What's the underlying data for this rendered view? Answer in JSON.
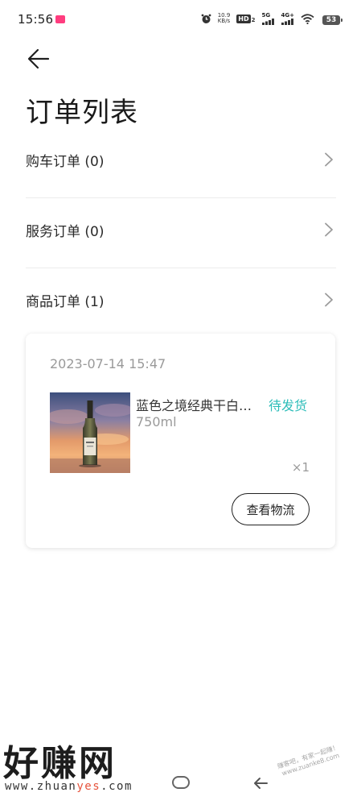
{
  "status_bar": {
    "time": "15:56",
    "net_speed_value": "10.9",
    "net_speed_unit": "KB/s",
    "hd_label": "HD",
    "hd_index": "2",
    "signal1_label": "5G",
    "signal2_label": "4G+",
    "battery_level": "53"
  },
  "page": {
    "title": "订单列表"
  },
  "orders": {
    "rows": [
      {
        "label": "购车订单 (0)"
      },
      {
        "label": "服务订单 (0)"
      },
      {
        "label": "商品订单 (1)"
      }
    ]
  },
  "order_card": {
    "time": "2023-07-14 15:47",
    "product_name": "蓝色之境经典干白…",
    "status": "待发货",
    "spec": "750ml",
    "qty": "×1",
    "logistics_button": "查看物流",
    "status_color": "#2dbdb9"
  },
  "watermark": {
    "logo": "好赚网",
    "url_prefix": "www.zhuan",
    "url_highlight": "yes",
    "url_suffix": ".com",
    "stamp_line1": "赚客吧，有家一起赚！",
    "stamp_line2": "www.zuanke8.com"
  }
}
